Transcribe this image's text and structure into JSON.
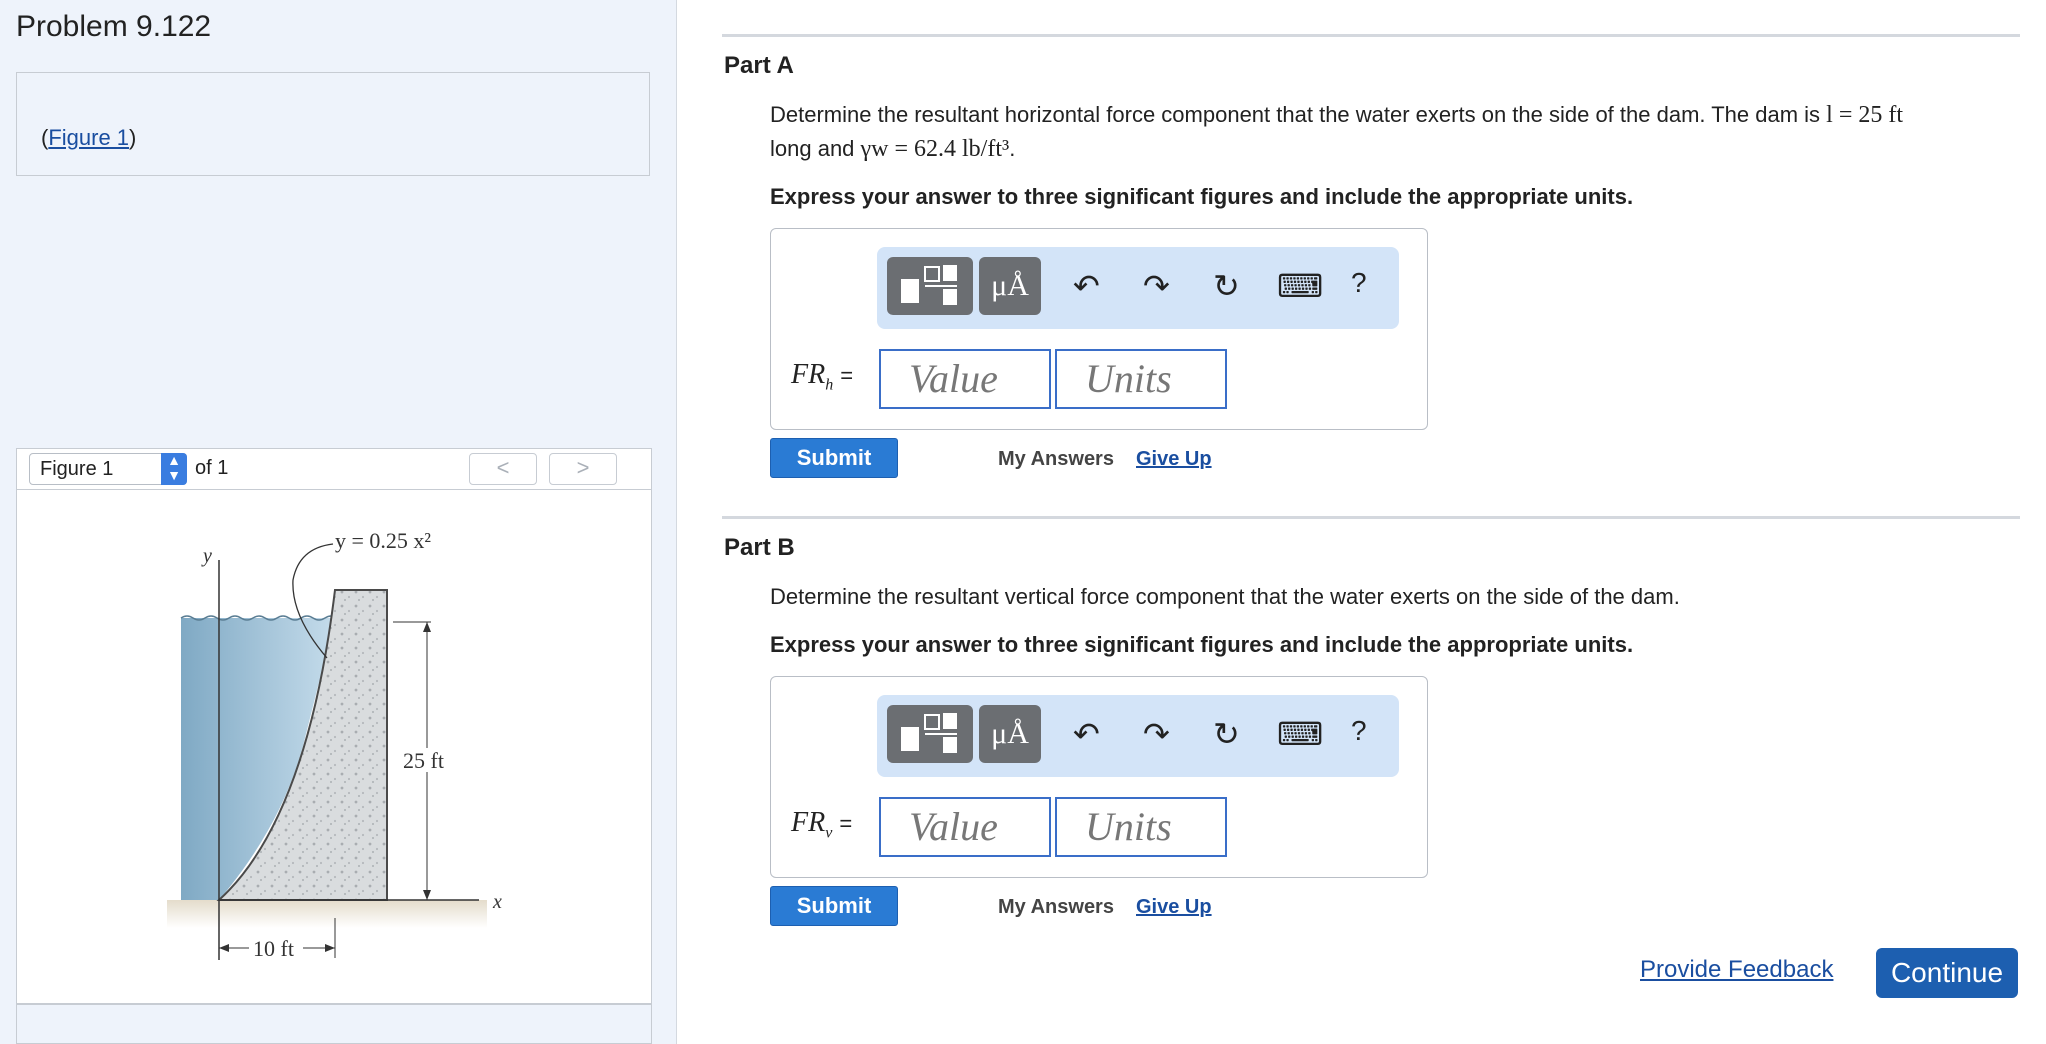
{
  "problem": {
    "title": "Problem 9.122"
  },
  "figure_link": {
    "open": "(",
    "label": "Figure 1",
    "close": ")"
  },
  "figure_viewer": {
    "selected": "Figure 1",
    "of_label": "of 1",
    "prev": "<",
    "next": ">",
    "figure": {
      "curve_label": "y = 0.25 x²",
      "y_axis": "y",
      "x_axis": "x",
      "height_label": "25 ft",
      "width_label": "10 ft"
    }
  },
  "part_a": {
    "title": "Part A",
    "prompt_start": "Determine the resultant horizontal force component that the water exerts on the side of the dam. The dam is ",
    "prompt_l": "l = 25 ft",
    "prompt_mid": "long and ",
    "prompt_gamma": "γw = 62.4 lb/ft³",
    "prompt_end": ".",
    "instruction": "Express your answer to three significant figures and include the appropriate units.",
    "field_label": "FR",
    "field_sub": "h",
    "field_eq": "=",
    "value_placeholder": "Value",
    "units_placeholder": "Units",
    "submit": "Submit",
    "my_answers": "My Answers",
    "give_up": "Give Up"
  },
  "part_b": {
    "title": "Part B",
    "prompt": "Determine the resultant vertical force component that the water exerts on the side of the dam.",
    "instruction": "Express your answer to three significant figures and include the appropriate units.",
    "field_label": "FR",
    "field_sub": "v",
    "field_eq": "=",
    "value_placeholder": "Value",
    "units_placeholder": "Units",
    "submit": "Submit",
    "my_answers": "My Answers",
    "give_up": "Give Up"
  },
  "toolbar": {
    "units_label": "μÅ",
    "undo": "↶",
    "redo": "↷",
    "reset": "↻",
    "keyboard": "⌨",
    "help": "?"
  },
  "footer": {
    "feedback": "Provide Feedback",
    "continue": "Continue"
  },
  "colors": {
    "accent": "#2a7bd4",
    "link": "#1a4ea0",
    "toolbar_bg": "#d3e4f8",
    "water": "#9cc2d8"
  }
}
